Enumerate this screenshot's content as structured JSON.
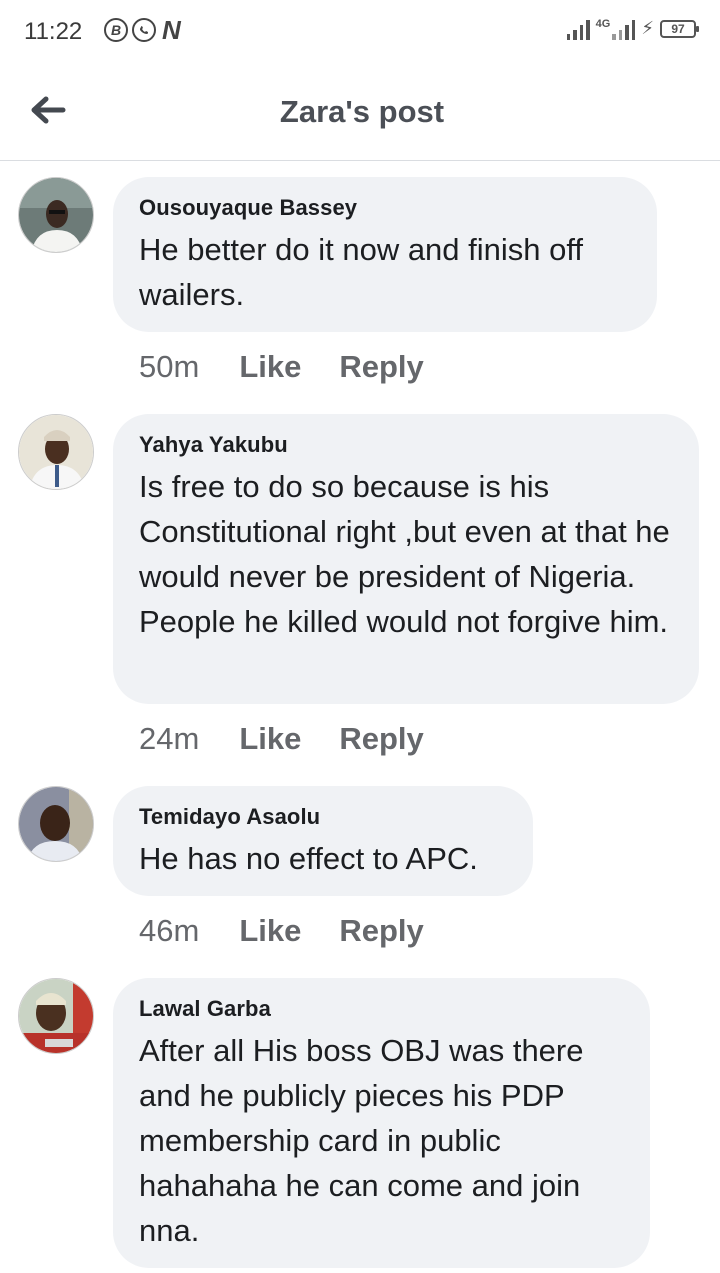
{
  "status_bar": {
    "time": "11:22",
    "app_icons": [
      "B",
      "whatsapp-icon",
      "N"
    ],
    "network": "4G",
    "battery": "97"
  },
  "header": {
    "title": "Zara's post"
  },
  "comments": [
    {
      "author": "Ousouyaque Bassey",
      "text": "He better do it now and finish off wailers.",
      "time": "50m",
      "like": "Like",
      "reply": "Reply"
    },
    {
      "author": "Yahya Yakubu",
      "text": "Is free to do so because is his Constitutional right ,but even at that he would never be president of Nigeria. People he killed would not forgive him.",
      "time": "24m",
      "like": "Like",
      "reply": "Reply"
    },
    {
      "author": "Temidayo Asaolu",
      "text": "He has no effect to APC.",
      "time": "46m",
      "like": "Like",
      "reply": "Reply"
    },
    {
      "author": "Lawal Garba",
      "text": "After all His boss OBJ was there and he publicly pieces his PDP membership card in public hahahaha he can come and join nna.",
      "time": "",
      "like": "",
      "reply": ""
    }
  ],
  "colors": {
    "bubble": "#f0f2f5",
    "secondary_text": "#65676b",
    "title": "#4b4f56"
  }
}
